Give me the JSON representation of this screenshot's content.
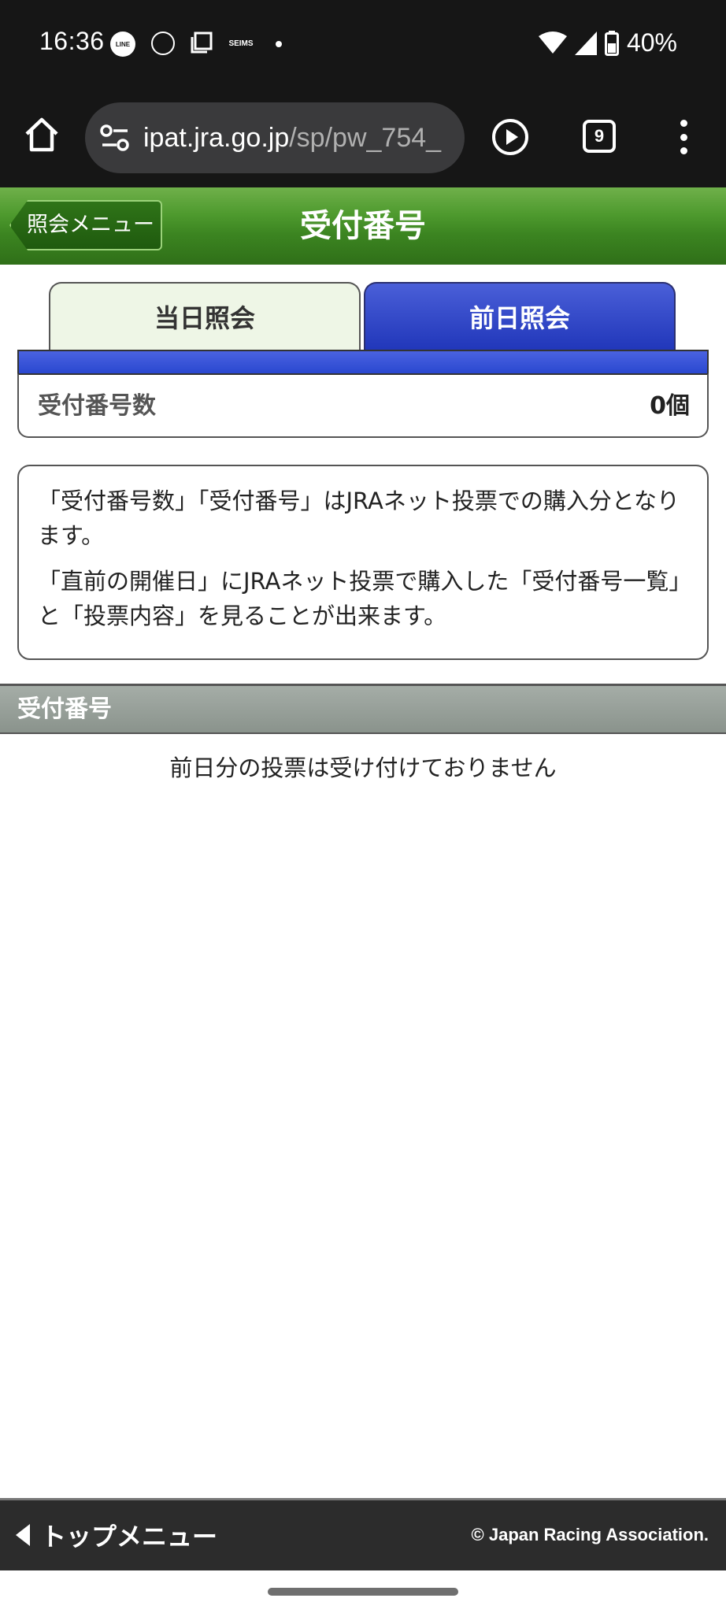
{
  "status_bar": {
    "time": "16:36",
    "battery": "40%",
    "notif_line": "LINE",
    "notif_seims": "SEIMS"
  },
  "browser": {
    "url_host": "ipat.jra.go.jp",
    "url_path": "/sp/pw_754_",
    "tab_count": "9"
  },
  "header": {
    "back_label": "照会メニュー",
    "title": "受付番号"
  },
  "tabs": {
    "today": "当日照会",
    "previous": "前日照会"
  },
  "count": {
    "label": "受付番号数",
    "value": "0個"
  },
  "info": {
    "paragraph1": "「受付番号数」「受付番号」はJRAネット投票での購入分となります。",
    "paragraph2": "「直前の開催日」にJRAネット投票で購入した「受付番号一覧」と「投票内容」を見ることが出来ます。"
  },
  "section": {
    "title": "受付番号",
    "empty_message": "前日分の投票は受け付けておりません"
  },
  "footer": {
    "top_menu": "トップメニュー",
    "copyright": "© Japan Racing Association."
  },
  "colors": {
    "header_green": "#3c8521",
    "tab_active_blue": "#1e34b8",
    "tab_inactive": "#eef6e6"
  }
}
